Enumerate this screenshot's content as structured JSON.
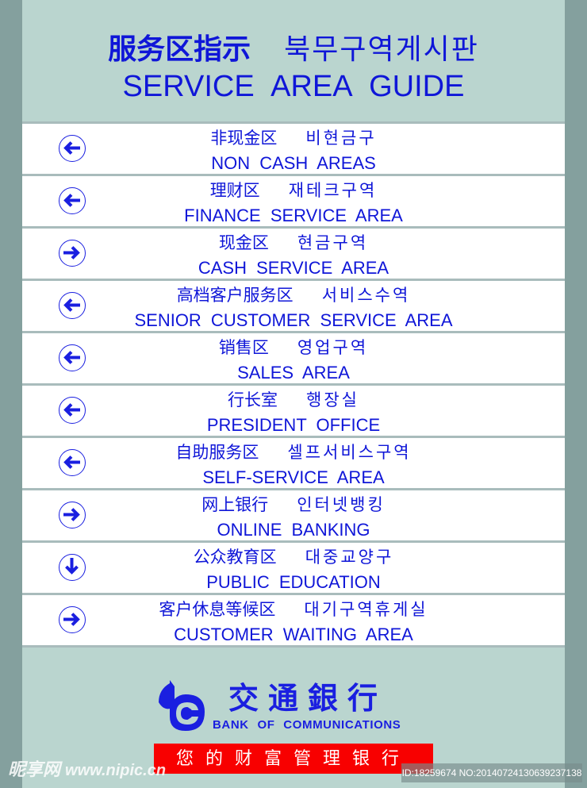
{
  "header": {
    "title_zh": "服务区指示",
    "title_ko": "북무구역게시판",
    "title_en": "SERVICE AREA GUIDE"
  },
  "rows": [
    {
      "direction": "left",
      "icon": "arrow-left-icon",
      "zh": "非现金区",
      "ko": "비현금구",
      "en": "NON CASH AREAS"
    },
    {
      "direction": "left",
      "icon": "arrow-left-icon",
      "zh": "理财区",
      "ko": "재테크구역",
      "en": "FINANCE SERVICE AREA"
    },
    {
      "direction": "right",
      "icon": "arrow-right-icon",
      "zh": "现金区",
      "ko": "현금구역",
      "en": "CASH SERVICE AREA"
    },
    {
      "direction": "left",
      "icon": "arrow-left-icon",
      "zh": "高档客户服务区",
      "ko": "서비스수역",
      "en": "SENIOR CUSTOMER SERVICE AREA"
    },
    {
      "direction": "left",
      "icon": "arrow-left-icon",
      "zh": "销售区",
      "ko": "영업구역",
      "en": "SALES AREA"
    },
    {
      "direction": "left",
      "icon": "arrow-left-icon",
      "zh": "行长室",
      "ko": "행장실",
      "en": "PRESIDENT OFFICE"
    },
    {
      "direction": "left",
      "icon": "arrow-left-icon",
      "zh": "自助服务区",
      "ko": "셀프서비스구역",
      "en": "SELF-SERVICE AREA"
    },
    {
      "direction": "right",
      "icon": "arrow-right-icon",
      "zh": "网上银行",
      "ko": "인터넷뱅킹",
      "en": "ONLINE BANKING"
    },
    {
      "direction": "down",
      "icon": "arrow-down-icon",
      "zh": "公众教育区",
      "ko": "대중교양구",
      "en": "PUBLIC EDUCATION"
    },
    {
      "direction": "right",
      "icon": "arrow-right-icon",
      "zh": "客户休息等候区",
      "ko": "대기구역휴게실",
      "en": "CUSTOMER WAITING AREA"
    }
  ],
  "footer": {
    "bank_name_zh": "交通銀行",
    "bank_name_en": "BANK OF COMMUNICATIONS",
    "slogan": "您的财富管理银行"
  },
  "watermark": {
    "site_name": "昵享网",
    "site_url": "www.nipic.cn",
    "id_text": "ID:18259674 NO:20140724130639237138"
  },
  "colors": {
    "text_blue": "#0f16d8",
    "board_bg": "#bad5cf",
    "frame": "#84a09e",
    "slogan_red": "#f80000"
  }
}
